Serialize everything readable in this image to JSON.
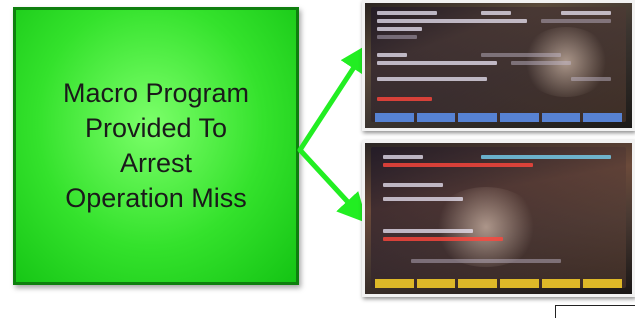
{
  "slide": {
    "callout": {
      "lines": [
        "Macro Program",
        "Provided To",
        "Arrest",
        "Operation Miss"
      ]
    },
    "photos": [
      {
        "name": "cnc-screen-photo-top"
      },
      {
        "name": "cnc-screen-photo-bottom"
      }
    ],
    "colors": {
      "callout_fill": "#34e22c",
      "callout_border": "#0e7f0e",
      "arrow": "#22ee22"
    }
  }
}
